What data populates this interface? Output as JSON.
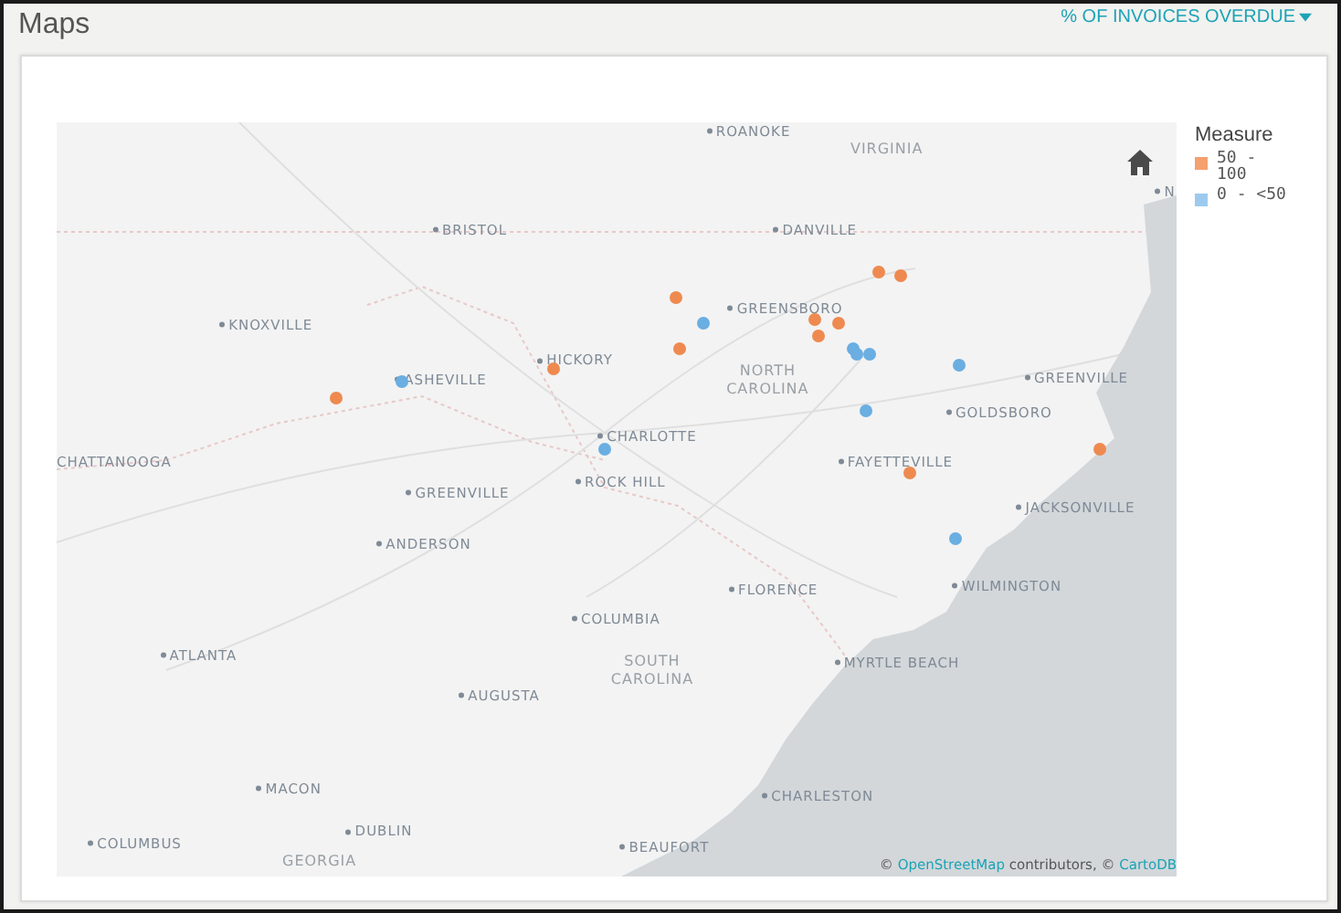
{
  "header": {
    "title": "Maps",
    "measure_dropdown": {
      "label": "% OF INVOICES OVERDUE"
    }
  },
  "map": {
    "labels": [
      {
        "kind": "city",
        "text": "ROANOKE"
      },
      {
        "kind": "region",
        "text": "VIRGINIA"
      },
      {
        "kind": "city",
        "text": "BRISTOL"
      },
      {
        "kind": "city",
        "text": "DANVILLE"
      },
      {
        "kind": "city",
        "text": "GREENSBORO"
      },
      {
        "kind": "city",
        "text": "KNOXVILLE"
      },
      {
        "kind": "city",
        "text": "HICKORY"
      },
      {
        "kind": "city",
        "text": "ASHEVILLE"
      },
      {
        "kind": "region",
        "text": "NORTH CAROLINA"
      },
      {
        "kind": "city",
        "text": "GREENVILLE"
      },
      {
        "kind": "city",
        "text": "CHARLOTTE"
      },
      {
        "kind": "city",
        "text": "GOLDSBORO"
      },
      {
        "kind": "edge",
        "text": "CHATTANOOGA"
      },
      {
        "kind": "city",
        "text": "ROCK HILL"
      },
      {
        "kind": "city",
        "text": "FAYETTEVILLE"
      },
      {
        "kind": "city",
        "text": "GREENVILLE"
      },
      {
        "kind": "city",
        "text": "JACKSONVILLE"
      },
      {
        "kind": "city",
        "text": "ANDERSON"
      },
      {
        "kind": "city",
        "text": "FLORENCE"
      },
      {
        "kind": "city",
        "text": "WILMINGTON"
      },
      {
        "kind": "city",
        "text": "COLUMBIA"
      },
      {
        "kind": "region",
        "text": "SOUTH CAROLINA"
      },
      {
        "kind": "city",
        "text": "ATLANTA"
      },
      {
        "kind": "city",
        "text": "MYRTLE BEACH"
      },
      {
        "kind": "city",
        "text": "AUGUSTA"
      },
      {
        "kind": "city",
        "text": "CHARLESTON"
      },
      {
        "kind": "city",
        "text": "MACON"
      },
      {
        "kind": "city",
        "text": "DUBLIN"
      },
      {
        "kind": "city",
        "text": "COLUMBUS"
      },
      {
        "kind": "region",
        "text": "GEORGIA"
      },
      {
        "kind": "city",
        "text": "BEAUFORT"
      },
      {
        "kind": "city",
        "text": "N"
      }
    ],
    "markers": [
      {
        "color": "#ee8a4f"
      },
      {
        "color": "#ee8a4f"
      },
      {
        "color": "#ee8a4f"
      },
      {
        "color": "#ee8a4f"
      },
      {
        "color": "#ee8a4f"
      },
      {
        "color": "#ee8a4f"
      },
      {
        "color": "#ee8a4f"
      },
      {
        "color": "#ee8a4f"
      },
      {
        "color": "#ee8a4f"
      },
      {
        "color": "#ee8a4f"
      },
      {
        "color": "#ee8a4f"
      },
      {
        "color": "#6aaee2"
      },
      {
        "color": "#6aaee2"
      },
      {
        "color": "#6aaee2"
      },
      {
        "color": "#6aaee2"
      },
      {
        "color": "#6aaee2"
      },
      {
        "color": "#6aaee2"
      },
      {
        "color": "#6aaee2"
      },
      {
        "color": "#6aaee2"
      },
      {
        "color": "#6aaee2"
      }
    ],
    "attribution": [
      {
        "kind": "plain",
        "text": "© "
      },
      {
        "kind": "link",
        "text": "OpenStreetMap"
      },
      {
        "kind": "plain",
        "text": " contributors, © "
      },
      {
        "kind": "link",
        "text": "CartoDB"
      }
    ]
  },
  "legend": {
    "title": "Measure",
    "items": [
      {
        "label": "50 - 100",
        "color": "#f5a06e"
      },
      {
        "label": "0 - <50",
        "color": "#9ccaef"
      }
    ]
  }
}
